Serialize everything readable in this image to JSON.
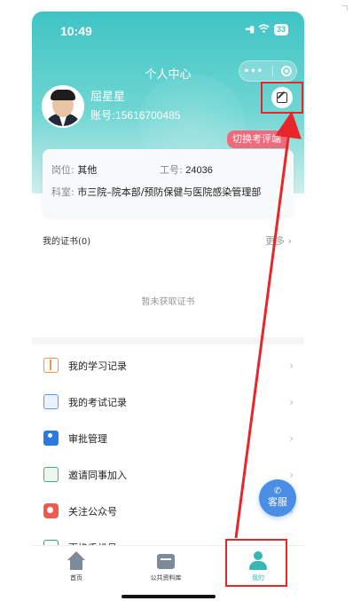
{
  "status_bar": {
    "time": "10:49",
    "battery": "33"
  },
  "nav": {
    "title": "个人中心",
    "capsule_dots": "•••"
  },
  "profile": {
    "name": "屈星星",
    "account_label": "账号:",
    "account_value": "15616700485"
  },
  "switch_badge": "切换考评端",
  "info": {
    "position_label": "岗位:",
    "position_value": "其他",
    "employee_label": "工号:",
    "employee_value": "24036",
    "department_label": "科室:",
    "department_value": "市三院–院本部/预防保健与医院感染管理部"
  },
  "certificates": {
    "title": "我的证书(0)",
    "more": "更多 ›",
    "empty": "暂未获取证书"
  },
  "menu": {
    "items": [
      {
        "label": "我的学习记录",
        "icon": "book-icon"
      },
      {
        "label": "我的考试记录",
        "icon": "exam-icon"
      },
      {
        "label": "审批管理",
        "icon": "approve-icon"
      },
      {
        "label": "邀请同事加入",
        "icon": "share-icon"
      },
      {
        "label": "关注公众号",
        "icon": "wechat-icon"
      },
      {
        "label": "更换手机号",
        "icon": "phone-icon"
      }
    ],
    "chevron": "›"
  },
  "service": {
    "label": "客服",
    "icon": "phone-icon"
  },
  "tabs": {
    "home": "首页",
    "library": "公共资料库",
    "mine": "我的"
  },
  "colors": {
    "header_teal": "#3fc4c4",
    "accent": "#37b7b4",
    "badge_pink": "#ef6a7a",
    "highlight_red": "#e8262a",
    "service_blue": "#4a8ee6"
  }
}
